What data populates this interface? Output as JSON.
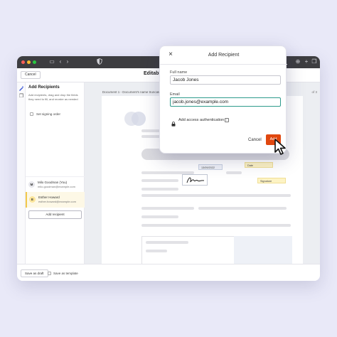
{
  "browser": {
    "icons": [
      "back-icon",
      "forward-icon",
      "shield-icon",
      "download-icon",
      "add-tab-icon",
      "tabs-icon"
    ]
  },
  "toolbar": {
    "cancel_label": "Cancel",
    "title": "Editabl"
  },
  "sidebar": {
    "title": "Add Recipients",
    "description": "Add recipients, drag and drop the fields they need to fill, and reorder as needed",
    "signing_order_label": "Set signing order",
    "recipients": [
      {
        "initial": "M",
        "name": "Milo Goodman (You)",
        "email": "milo.goodman@example.com",
        "color": "#e7e7ec"
      },
      {
        "initial": "E",
        "name": "Esther Howard",
        "email": "esther.howard@example.com",
        "color": "#fbe59a"
      }
    ],
    "add_recipient_label": "Add recipient"
  },
  "canvas": {
    "doc_label": "Document 1 - Document's name truncate",
    "page_label": "of 3",
    "fields": {
      "date_value": "13/09/2022",
      "date_label": "Date",
      "signature_label": "Signature"
    }
  },
  "footer": {
    "save_draft_label": "Save as draft",
    "save_template_label": "Save as template"
  },
  "modal": {
    "title": "Add Recipient",
    "full_name_label": "Full name",
    "full_name_value": "Jacob Jones",
    "email_label": "Email",
    "email_value": "jacob.jones@example.com",
    "access_auth_label": "Add access authentication",
    "cancel_label": "Cancel",
    "add_label": "Add"
  },
  "colors": {
    "accent_button": "#e0470f",
    "focus_border": "#2e9b8c",
    "signer_highlight": "#fdf3c4"
  }
}
